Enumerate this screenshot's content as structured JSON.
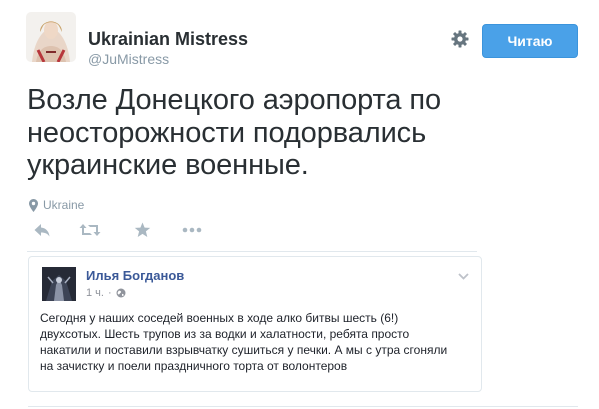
{
  "author": {
    "display_name": "Ukrainian Mistress",
    "handle": "@JuMistress"
  },
  "header": {
    "follow_button_label": "Читаю",
    "settings_icon": "gear-icon"
  },
  "tweet": {
    "text": "Возле Донецкого аэропорта по неосторожности подорвались украинские военные.",
    "location": "Ukraine",
    "location_icon": "map-pin-icon"
  },
  "actions": [
    "reply-icon",
    "retweet-icon",
    "favorite-icon",
    "more-icon"
  ],
  "embedded_post": {
    "author_name": "Илья Богданов",
    "time": "1 ч.",
    "audience_icon": "globe-icon",
    "body": "Сегодня у наших соседей военных в ходе алко битвы шесть (6!) двухсотых. Шесть трупов из за водки и халатности, ребята просто накатили и поставили взрывчатку сушиться у печки. А мы с утра сгоняли на зачистку и поели праздничного торта от волонтеров"
  },
  "colors": {
    "accent": "#4aa1e8",
    "muted": "#8899a6",
    "fb_link": "#3b5998",
    "text": "#292f33"
  }
}
